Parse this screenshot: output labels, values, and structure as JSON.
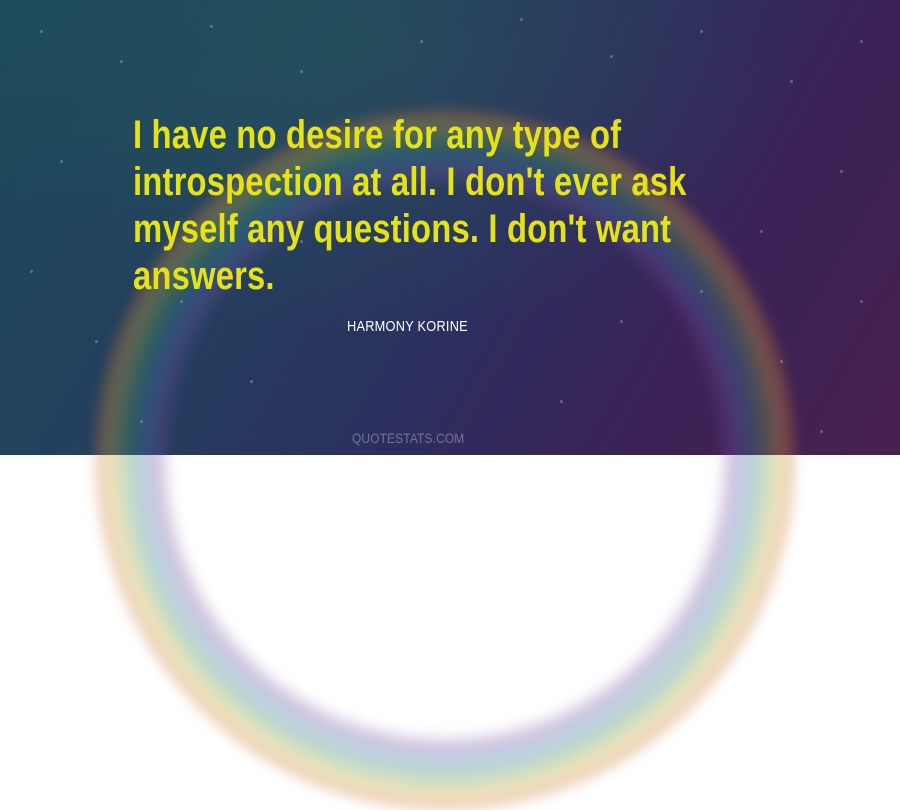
{
  "quote": {
    "text": "I have no desire for any type of introspection at all. I don't ever ask myself any questions. I don't want answers.",
    "color": "#e6e218"
  },
  "author": {
    "name": "HARMONY KORINE",
    "color": "#ffffff"
  },
  "watermark": {
    "text": "QUOTESTATS.COM"
  }
}
